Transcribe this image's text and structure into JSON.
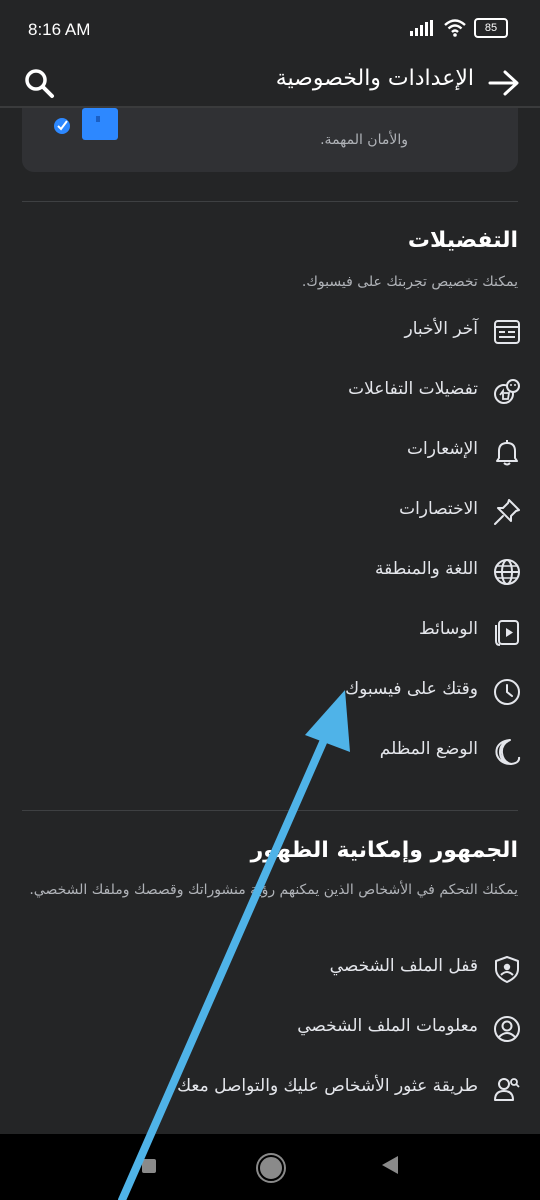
{
  "status": {
    "time": "8:16 AM",
    "battery": "85"
  },
  "header": {
    "title": "الإعدادات والخصوصية"
  },
  "card": {
    "text": "والأمان المهمة."
  },
  "preferences": {
    "title": "التفضيلات",
    "subtitle": "يمكنك تخصيص تجربتك على فيسبوك.",
    "items": [
      {
        "label": "آخر الأخبار",
        "icon": "news-feed-icon"
      },
      {
        "label": "تفضيلات التفاعلات",
        "icon": "reactions-icon"
      },
      {
        "label": "الإشعارات",
        "icon": "bell-icon"
      },
      {
        "label": "الاختصارات",
        "icon": "pin-icon"
      },
      {
        "label": "اللغة والمنطقة",
        "icon": "globe-icon"
      },
      {
        "label": "الوسائط",
        "icon": "media-icon"
      },
      {
        "label": "وقتك على فيسبوك",
        "icon": "clock-icon"
      },
      {
        "label": "الوضع المظلم",
        "icon": "moon-icon"
      }
    ]
  },
  "audience": {
    "title": "الجمهور وإمكانية الظهور",
    "subtitle": "يمكنك التحكم في الأشخاص الذين يمكنهم رؤية منشوراتك وقصصك وملفك الشخصي.",
    "items": [
      {
        "label": "قفل الملف الشخصي",
        "icon": "shield-user-icon"
      },
      {
        "label": "معلومات الملف الشخصي",
        "icon": "profile-circle-icon"
      },
      {
        "label": "طريقة عثور الأشخاص عليك والتواصل معك",
        "icon": "people-search-icon"
      }
    ]
  },
  "colors": {
    "background": "#242526",
    "annotation_arrow": "#4fb3e8",
    "card_accent": "#2d88ff"
  }
}
